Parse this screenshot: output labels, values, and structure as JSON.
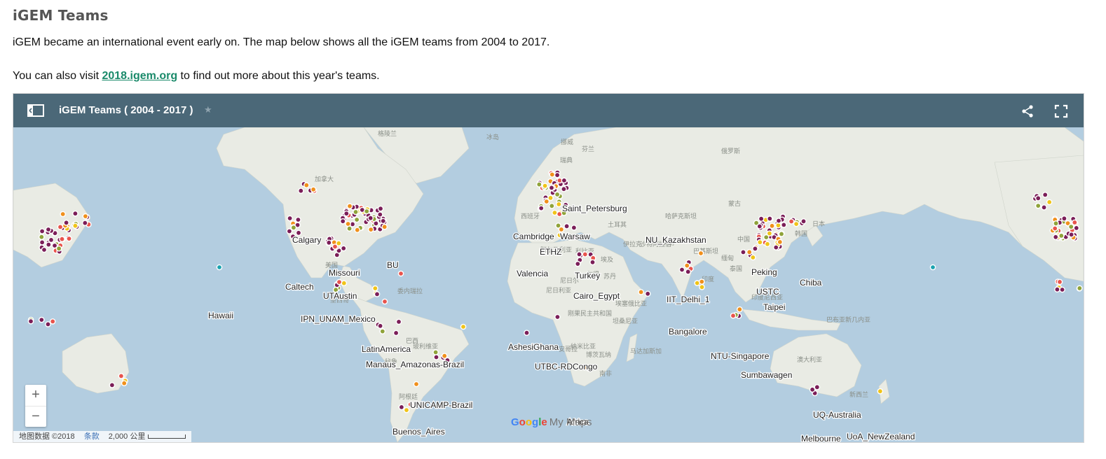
{
  "heading": "iGEM Teams",
  "intro": "iGEM became an international event early on. The map below shows all the iGEM teams from 2004 to 2017.",
  "visit": {
    "before": "You can also visit ",
    "link": "2018.igem.org",
    "after": " to find out more about this year's teams."
  },
  "map_header": {
    "title": "iGEM Teams ( 2004 - 2017 )",
    "star": "★",
    "legend_icon": "legend-panel-icon",
    "share_icon": "share-icon",
    "fullscreen_icon": "fullscreen-icon"
  },
  "colors": {
    "header": "#4b6878",
    "water": "#b3cde0",
    "land": "#e9ebe4",
    "marker_main": "#7b1e58",
    "marker_olive": "#8fa33a",
    "marker_yellow": "#f0c419",
    "marker_orange": "#f0901c",
    "marker_red": "#e8544d",
    "marker_teal": "#1aa3b0",
    "link": "#1a8a6a"
  },
  "zoom": {
    "in": "+",
    "out": "−"
  },
  "attribution": {
    "data": "地图数据 ©2018",
    "terms": "条款",
    "scale": "2,000 公里"
  },
  "logo": {
    "google": "Google",
    "mymaps": "My Maps"
  },
  "cities": [
    "Saint_Petersburg",
    "Cambridge",
    "Warsaw",
    "ETHZ",
    "Valencia",
    "Turkey",
    "Cairo_Egypt",
    "NU_Kazakhstan",
    "IIT_Delhi_1",
    "Bangalore",
    "Peking",
    "USTC",
    "Chiba",
    "Taipei",
    "NTU-Singapore",
    "Sumbawagen",
    "AshesiGhana",
    "UTBC-RDCongo",
    "Africa",
    "Calgary",
    "Missouri",
    "BU",
    "Caltech",
    "UTAustin",
    "Hawaii",
    "IPN_UNAM_Mexico",
    "LatinAmerica",
    "Manaus_Amazonas-Brazil",
    "UNICAMP-Brazil",
    "Buenos_Aires",
    "UQ-Australia",
    "Melbourne",
    "UoA_NewZealand"
  ],
  "basemap_labels": [
    "加拿大",
    "美国",
    "墨西哥",
    "委内瑞拉",
    "巴西",
    "秘鲁",
    "玻利维亚",
    "阿根廷",
    "冰岛",
    "挪威",
    "瑞典",
    "芬兰",
    "俄罗斯",
    "哈萨克斯坦",
    "蒙古",
    "中国",
    "日本",
    "韩国",
    "印度",
    "伊朗",
    "伊拉克",
    "阿尔及利亚",
    "利比亚",
    "埃及",
    "马里",
    "尼日尔",
    "乍得",
    "苏丹",
    "尼日利亚",
    "埃塞俄比亚",
    "刚果民主共和国",
    "坦桑尼亚",
    "安哥拉",
    "纳米比亚",
    "博茨瓦纳",
    "南非",
    "马达加斯加",
    "沙特阿拉伯",
    "巴基斯坦",
    "印度尼西亚",
    "巴布亚新几内亚",
    "澳大利亚",
    "新西兰",
    "西班牙",
    "土耳其",
    "格陵兰",
    "泰国",
    "缅甸"
  ]
}
